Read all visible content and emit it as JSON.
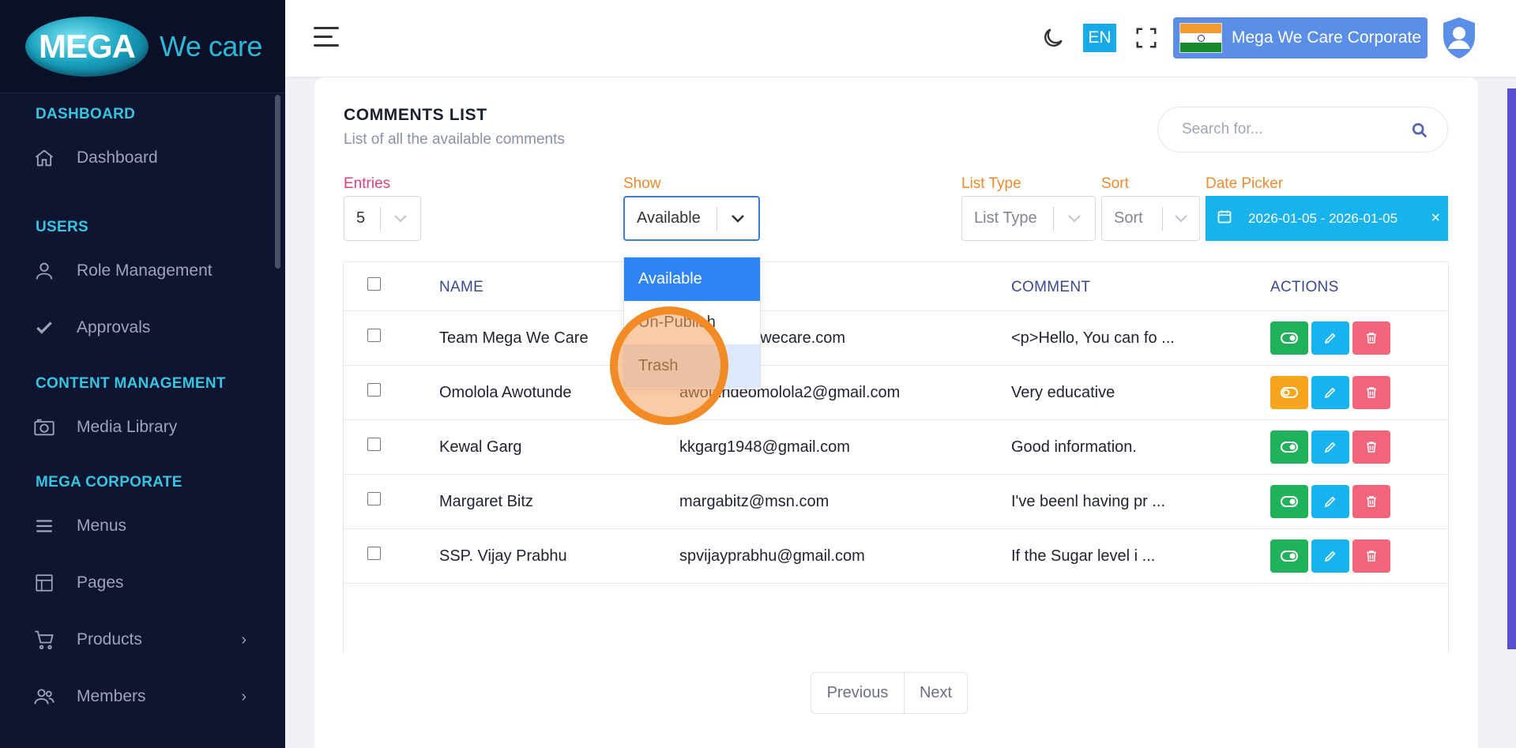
{
  "brand": {
    "logo_main": "MEGA",
    "logo_sub": "We care"
  },
  "sidebar": {
    "sections": [
      {
        "title": "DASHBOARD"
      },
      {
        "title": "USERS"
      },
      {
        "title": "CONTENT MANAGEMENT"
      },
      {
        "title": "MEGA CORPORATE"
      }
    ],
    "items": [
      {
        "label": "Dashboard",
        "icon": "home-icon"
      },
      {
        "label": "Role Management",
        "icon": "user-icon"
      },
      {
        "label": "Approvals",
        "icon": "check-icon"
      },
      {
        "label": "Media Library",
        "icon": "camera-icon"
      },
      {
        "label": "Menus",
        "icon": "menu-icon"
      },
      {
        "label": "Pages",
        "icon": "layout-icon"
      },
      {
        "label": "Products",
        "icon": "cart-icon",
        "chevron": "›"
      },
      {
        "label": "Members",
        "icon": "users-icon",
        "chevron": "›"
      }
    ]
  },
  "header": {
    "language": "EN",
    "corporate_label": "Mega We Care Corporate"
  },
  "page": {
    "title": "COMMENTS LIST",
    "subtitle": "List of all the available comments",
    "search_placeholder": "Search for..."
  },
  "filters": {
    "entries": {
      "label": "Entries",
      "value": "5"
    },
    "show": {
      "label": "Show",
      "value": "Available"
    },
    "list_type": {
      "label": "List Type",
      "value": "List Type"
    },
    "sort": {
      "label": "Sort",
      "value": "Sort"
    },
    "date_picker": {
      "label": "Date Picker",
      "value": "2026-01-05 - 2026-01-05",
      "clear": "×"
    }
  },
  "dropdown": {
    "options": [
      "Available",
      "Un-Publish",
      "Trash"
    ],
    "selected": "Available",
    "hovered": "Trash"
  },
  "table": {
    "columns": {
      "name": "NAME",
      "comment": "COMMENT",
      "actions": "ACTIONS"
    },
    "rows": [
      {
        "name": "Team Mega We Care",
        "email": "gawecare.com",
        "comment": "<p>Hello, You can fo ...",
        "status": "published"
      },
      {
        "name": "Omolola Awotunde",
        "email": "awotundeomolola2@gmail.com",
        "comment": "Very educative",
        "status": "unpublished"
      },
      {
        "name": "Kewal Garg",
        "email": "kkgarg1948@gmail.com",
        "comment": "Good information.",
        "status": "published"
      },
      {
        "name": "Margaret Bitz",
        "email": "margabitz@msn.com",
        "comment": "I've beenl having pr ...",
        "status": "published"
      },
      {
        "name": "SSP. Vijay Prabhu",
        "email": "spvijayprabhu@gmail.com",
        "comment": "If the Sugar level i ...",
        "status": "published"
      }
    ]
  },
  "pagination": {
    "previous": "Previous",
    "next": "Next"
  },
  "colors": {
    "sidebar_bg": "#0f1431",
    "section_title": "#35c5e0",
    "toggle_on": "#1fb25a",
    "toggle_off": "#f7a51e",
    "edit": "#16b3ee",
    "delete": "#f2647a",
    "accent_blue": "#2d84f7"
  }
}
